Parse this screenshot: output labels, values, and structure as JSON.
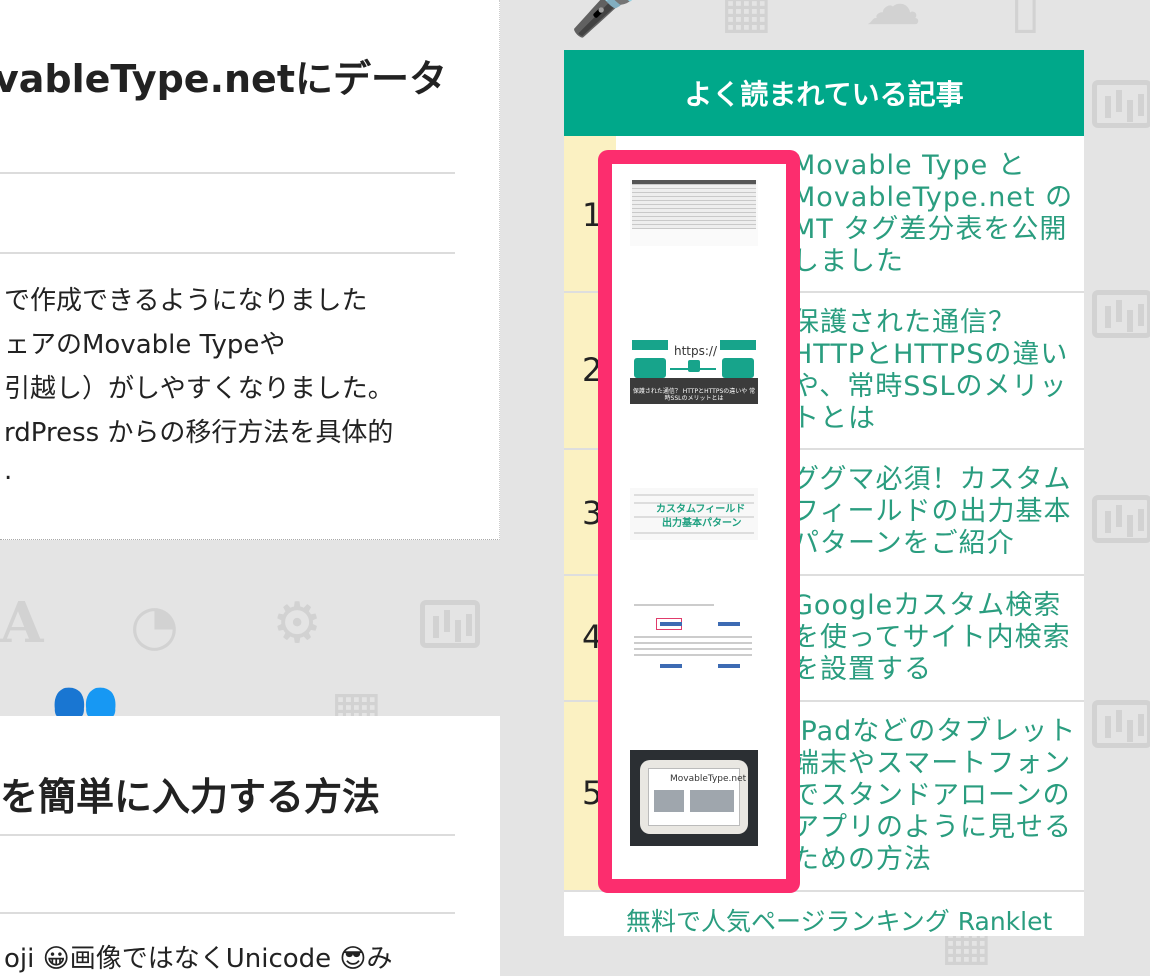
{
  "article_1": {
    "title": "ovableType.netにデータ",
    "body_lines": [
      "で作成できるようになりました",
      "ェアのMovable Typeや",
      "引越し）がしやすくなりました。",
      "rdPress からの移行方法を具体的",
      "."
    ]
  },
  "article_2": {
    "title": "を簡単に入力する方法",
    "body_line": "oji 😀画像ではなくUnicode 😎み"
  },
  "ranking": {
    "header": "よく読まれている記事",
    "items": [
      {
        "rank": "1",
        "title": "Movable Type と MovableType.net の MT タグ差分表を公開しました"
      },
      {
        "rank": "2",
        "title": "保護された通信？HTTPとHTTPSの違いや、常時SSLのメリットとは"
      },
      {
        "rank": "3",
        "title": "ググマ必須！カスタムフィールドの出力基本パターンをご紹介"
      },
      {
        "rank": "4",
        "title": "Googleカスタム検索を使ってサイト内検索を設置する"
      },
      {
        "rank": "5",
        "title": "iPadなどのタブレット端末やスマートフォンでスタンドアローンのアプリのように見せるための方法"
      }
    ],
    "footer": "無料で人気ページランキング Ranklet"
  },
  "thumbnails": {
    "https_text": "https://",
    "https_caption": "保護された通信？ HTTPとHTTPSの違いや 常時SSLのメリットとは",
    "field_label_1": "カスタムフィールド",
    "field_label_2": "出力基本パターン",
    "ipad_logo": "MovableType.net"
  },
  "colors": {
    "accent": "#00a88a",
    "link": "#2a9d7f",
    "highlight": "#fc2d6e",
    "rank_bg": "#fbf1c2"
  }
}
